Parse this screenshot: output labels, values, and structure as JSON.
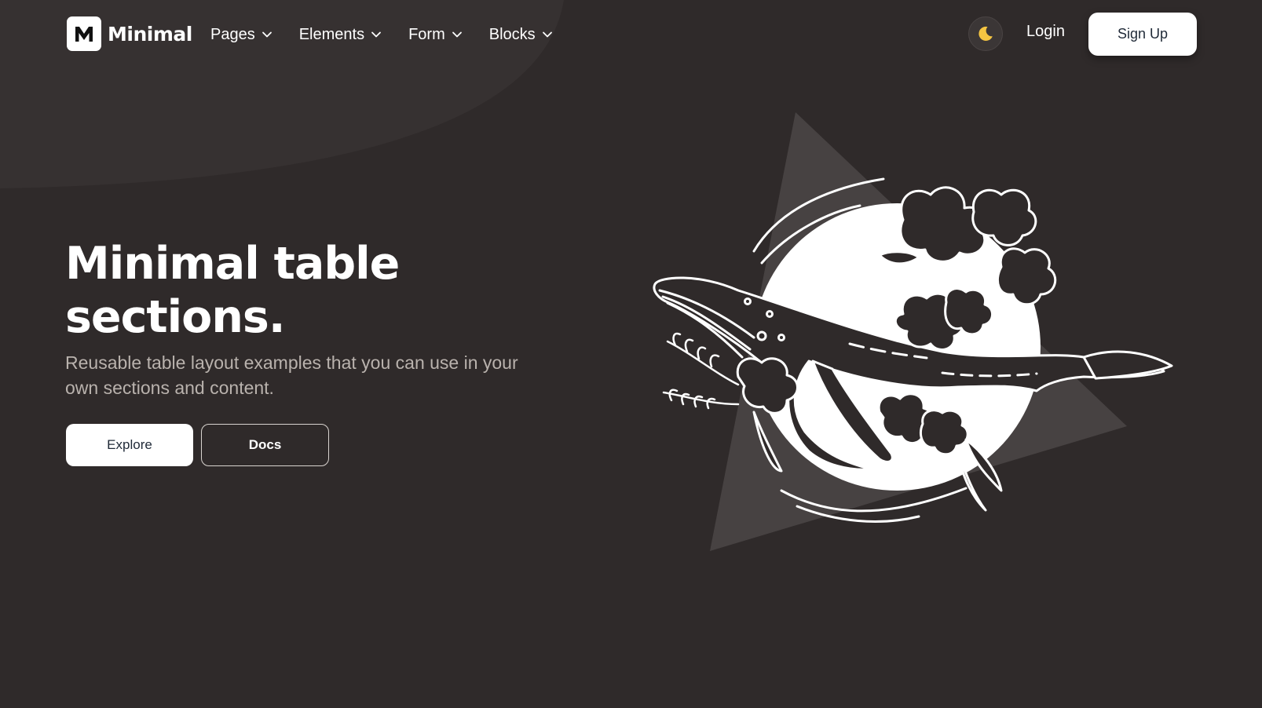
{
  "brand": {
    "name": "Minimal",
    "logo_letter": "M"
  },
  "nav": {
    "items": [
      {
        "label": "Pages",
        "icon": "chevron-down-icon"
      },
      {
        "label": "Elements",
        "icon": "chevron-down-icon"
      },
      {
        "label": "Form",
        "icon": "chevron-down-icon"
      },
      {
        "label": "Blocks",
        "icon": "chevron-down-icon"
      }
    ]
  },
  "header": {
    "theme_toggle_icon": "moon-icon",
    "login_label": "Login",
    "signup_label": "Sign Up"
  },
  "hero": {
    "title": "Minimal table sections.",
    "subtitle": "Reusable table layout examples that you can use in your own sections and content.",
    "explore_label": "Explore",
    "docs_label": "Docs",
    "illustration": "whale-with-flowers-illustration"
  },
  "colors": {
    "background": "#2f2a2a",
    "blob": "#363131",
    "triangle": "#474242",
    "moon": "#f5c542",
    "button_bg": "#ffffff",
    "subtitle": "#b9b2ad"
  }
}
